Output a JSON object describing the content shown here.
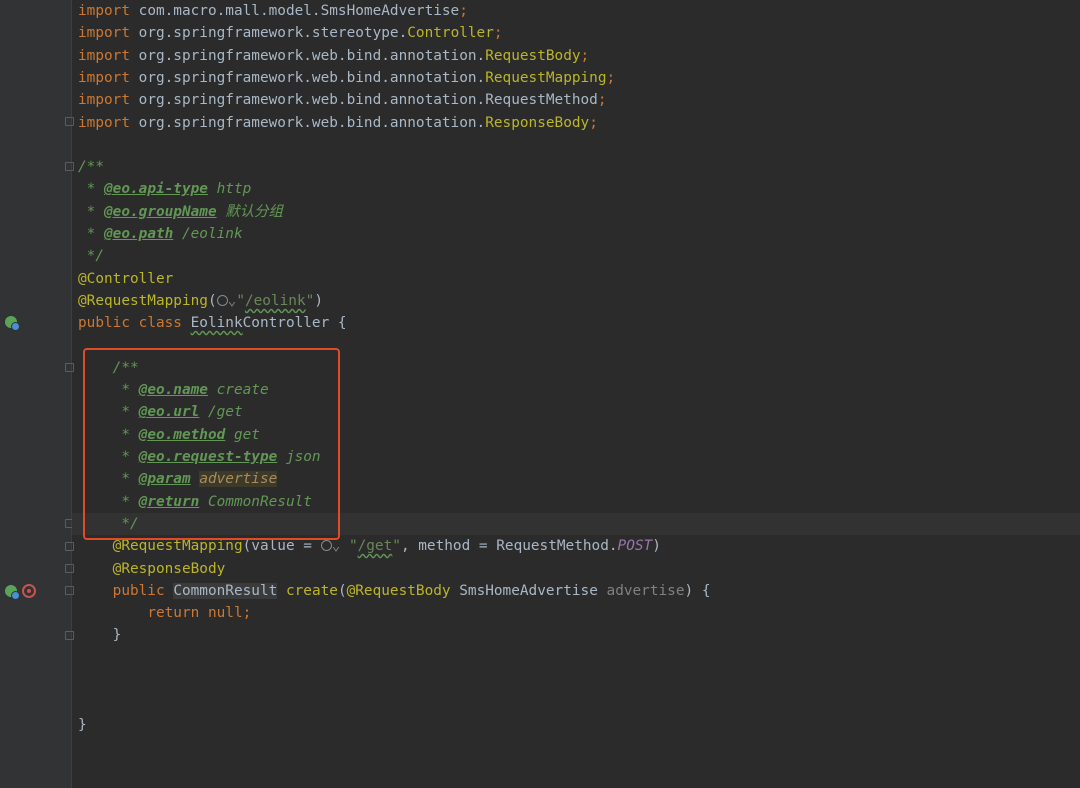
{
  "editor": {
    "lines": [
      {
        "id": "l1",
        "tokens": [
          {
            "t": "import ",
            "c": "kw"
          },
          {
            "t": "com.macro.mall.model.SmsHomeAdvertise"
          },
          {
            "t": ";",
            "c": "kw"
          }
        ]
      },
      {
        "id": "l2",
        "tokens": [
          {
            "t": "import ",
            "c": "kw"
          },
          {
            "t": "org.springframework.stereotype."
          },
          {
            "t": "Controller",
            "c": "ann"
          },
          {
            "t": ";",
            "c": "kw"
          }
        ]
      },
      {
        "id": "l3",
        "tokens": [
          {
            "t": "import ",
            "c": "kw"
          },
          {
            "t": "org.springframework.web.bind.annotation."
          },
          {
            "t": "RequestBody",
            "c": "ann"
          },
          {
            "t": ";",
            "c": "kw"
          }
        ]
      },
      {
        "id": "l4",
        "tokens": [
          {
            "t": "import ",
            "c": "kw"
          },
          {
            "t": "org.springframework.web.bind.annotation."
          },
          {
            "t": "RequestMapping",
            "c": "ann"
          },
          {
            "t": ";",
            "c": "kw"
          }
        ]
      },
      {
        "id": "l5",
        "tokens": [
          {
            "t": "import ",
            "c": "kw"
          },
          {
            "t": "org.springframework.web.bind.annotation.RequestMethod"
          },
          {
            "t": ";",
            "c": "kw"
          }
        ]
      },
      {
        "id": "l6",
        "tokens": [
          {
            "t": "import ",
            "c": "kw"
          },
          {
            "t": "org.springframework.web.bind.annotation."
          },
          {
            "t": "ResponseBody",
            "c": "ann"
          },
          {
            "t": ";",
            "c": "kw"
          }
        ]
      },
      {
        "id": "l7",
        "tokens": []
      },
      {
        "id": "l8",
        "tokens": [
          {
            "t": "/**",
            "c": "doc"
          }
        ]
      },
      {
        "id": "l9",
        "tokens": [
          {
            "t": " * ",
            "c": "doc"
          },
          {
            "t": "@eo.api-type",
            "c": "doctag"
          },
          {
            "t": " http",
            "c": "docval"
          }
        ]
      },
      {
        "id": "l10",
        "tokens": [
          {
            "t": " * ",
            "c": "doc"
          },
          {
            "t": "@eo.groupName",
            "c": "doctag"
          },
          {
            "t": " 默认分组",
            "c": "docval"
          }
        ]
      },
      {
        "id": "l11",
        "tokens": [
          {
            "t": " * ",
            "c": "doc"
          },
          {
            "t": "@eo.path",
            "c": "doctag"
          },
          {
            "t": " /eolink",
            "c": "docval"
          }
        ]
      },
      {
        "id": "l12",
        "tokens": [
          {
            "t": " */",
            "c": "doc"
          }
        ]
      },
      {
        "id": "l13",
        "tokens": [
          {
            "t": "@Controller",
            "c": "ann"
          }
        ]
      },
      {
        "id": "l14",
        "tokens": [
          {
            "t": "@RequestMapping",
            "c": "ann"
          },
          {
            "t": "("
          },
          {
            "t": "GLOBE",
            "c": "globe"
          },
          {
            "t": "⌄",
            "c": "dim"
          },
          {
            "t": "\"",
            "c": "str"
          },
          {
            "t": "/eolink",
            "c": "str typo"
          },
          {
            "t": "\"",
            "c": "str"
          },
          {
            "t": ")"
          }
        ]
      },
      {
        "id": "l15",
        "tokens": [
          {
            "t": "public ",
            "c": "kw"
          },
          {
            "t": "class ",
            "c": "kw"
          },
          {
            "t": "Eolink",
            "c": "typo"
          },
          {
            "t": "Controller {"
          }
        ]
      },
      {
        "id": "l16",
        "tokens": []
      },
      {
        "id": "l17",
        "tokens": [
          {
            "t": "    /**",
            "c": "doc"
          }
        ]
      },
      {
        "id": "l18",
        "tokens": [
          {
            "t": "     * ",
            "c": "doc"
          },
          {
            "t": "@eo.name",
            "c": "doctag"
          },
          {
            "t": " create",
            "c": "docval"
          }
        ]
      },
      {
        "id": "l19",
        "tokens": [
          {
            "t": "     * ",
            "c": "doc"
          },
          {
            "t": "@eo.url",
            "c": "doctag"
          },
          {
            "t": " /get",
            "c": "docval"
          }
        ]
      },
      {
        "id": "l20",
        "tokens": [
          {
            "t": "     * ",
            "c": "doc"
          },
          {
            "t": "@eo.method",
            "c": "doctag"
          },
          {
            "t": " get",
            "c": "docval"
          }
        ]
      },
      {
        "id": "l21",
        "tokens": [
          {
            "t": "     * ",
            "c": "doc"
          },
          {
            "t": "@eo.request-type",
            "c": "doctag"
          },
          {
            "t": " json",
            "c": "docval"
          }
        ]
      },
      {
        "id": "l22",
        "tokens": [
          {
            "t": "     * ",
            "c": "doc"
          },
          {
            "t": "@param",
            "c": "doctag"
          },
          {
            "t": " "
          },
          {
            "t": "advertise",
            "c": "paramname"
          }
        ]
      },
      {
        "id": "l23",
        "tokens": [
          {
            "t": "     * ",
            "c": "doc"
          },
          {
            "t": "@return",
            "c": "doctag"
          },
          {
            "t": " CommonResult",
            "c": "docval"
          }
        ]
      },
      {
        "id": "l24",
        "tokens": [
          {
            "t": "     */",
            "c": "doc"
          }
        ]
      },
      {
        "id": "l25",
        "tokens": [
          {
            "t": "    "
          },
          {
            "t": "@RequestMapping",
            "c": "ann"
          },
          {
            "t": "(value = "
          },
          {
            "t": "GLOBE",
            "c": "globe"
          },
          {
            "t": "⌄ ",
            "c": "dim"
          },
          {
            "t": "\"",
            "c": "str"
          },
          {
            "t": "/get",
            "c": "str typo"
          },
          {
            "t": "\"",
            "c": "str"
          },
          {
            "t": ", method = RequestMethod."
          },
          {
            "t": "POST",
            "c": "const"
          },
          {
            "t": ")"
          }
        ]
      },
      {
        "id": "l26",
        "tokens": [
          {
            "t": "    "
          },
          {
            "t": "@ResponseBody",
            "c": "ann"
          }
        ]
      },
      {
        "id": "l27",
        "tokens": [
          {
            "t": "    "
          },
          {
            "t": "public ",
            "c": "kw"
          },
          {
            "t": "CommonResult",
            "c": "hlword"
          },
          {
            "t": " "
          },
          {
            "t": "create",
            "c": "ann"
          },
          {
            "t": "("
          },
          {
            "t": "@RequestBody",
            "c": "ann"
          },
          {
            "t": " SmsHomeAdvertise "
          },
          {
            "t": "advertise",
            "c": "dim"
          },
          {
            "t": ") {"
          }
        ]
      },
      {
        "id": "l28",
        "tokens": [
          {
            "t": "        "
          },
          {
            "t": "return ",
            "c": "kw"
          },
          {
            "t": "null",
            "c": "kw"
          },
          {
            "t": ";",
            "c": "kw"
          }
        ]
      },
      {
        "id": "l29",
        "tokens": [
          {
            "t": "    }"
          }
        ]
      },
      {
        "id": "l30",
        "tokens": []
      },
      {
        "id": "l31",
        "tokens": []
      },
      {
        "id": "l32",
        "tokens": []
      },
      {
        "id": "l33",
        "tokens": [
          {
            "t": "}"
          }
        ]
      }
    ]
  },
  "gutter": {
    "icons": [
      {
        "name": "spring-bean-icon",
        "line": 15
      },
      {
        "name": "spring-bean-icon",
        "line": 27
      },
      {
        "name": "request-mapping-target-icon",
        "line": 27
      }
    ]
  }
}
